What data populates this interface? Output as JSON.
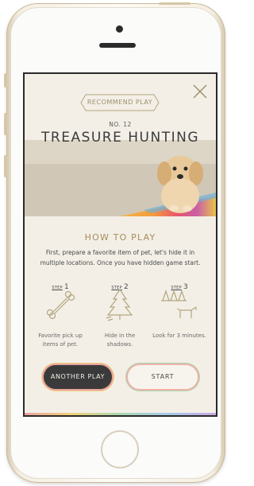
{
  "header": {
    "recommend_label": "RECOMMEND PLAY",
    "number_label": "NO. 12",
    "title": "TREASURE HUNTING"
  },
  "how_to": {
    "title": "HOW TO PLAY",
    "description": "First, prepare a favorite item of pet, let's hide it in multiple locations. Once you have hidden game start."
  },
  "steps": [
    {
      "word": "STEP",
      "number": "1",
      "icon": "bone-icon",
      "caption": "Favorite pick up items of pet."
    },
    {
      "word": "STEP",
      "number": "2",
      "icon": "tree-icon",
      "caption": "Hide in the shadows."
    },
    {
      "word": "STEP",
      "number": "3",
      "icon": "dog-in-trees-icon",
      "caption": "Look for 3 minutes."
    }
  ],
  "actions": {
    "another_label": "ANOTHER PLAY",
    "start_label": "START"
  },
  "colors": {
    "screen_bg": "#f3efe7",
    "accent_gold": "#a78d5a",
    "dark_button": "#3a3a3a",
    "gradient_pink": "#e9a3a0",
    "gradient_yellow": "#f0d27a",
    "gradient_green": "#a8d8b0"
  }
}
